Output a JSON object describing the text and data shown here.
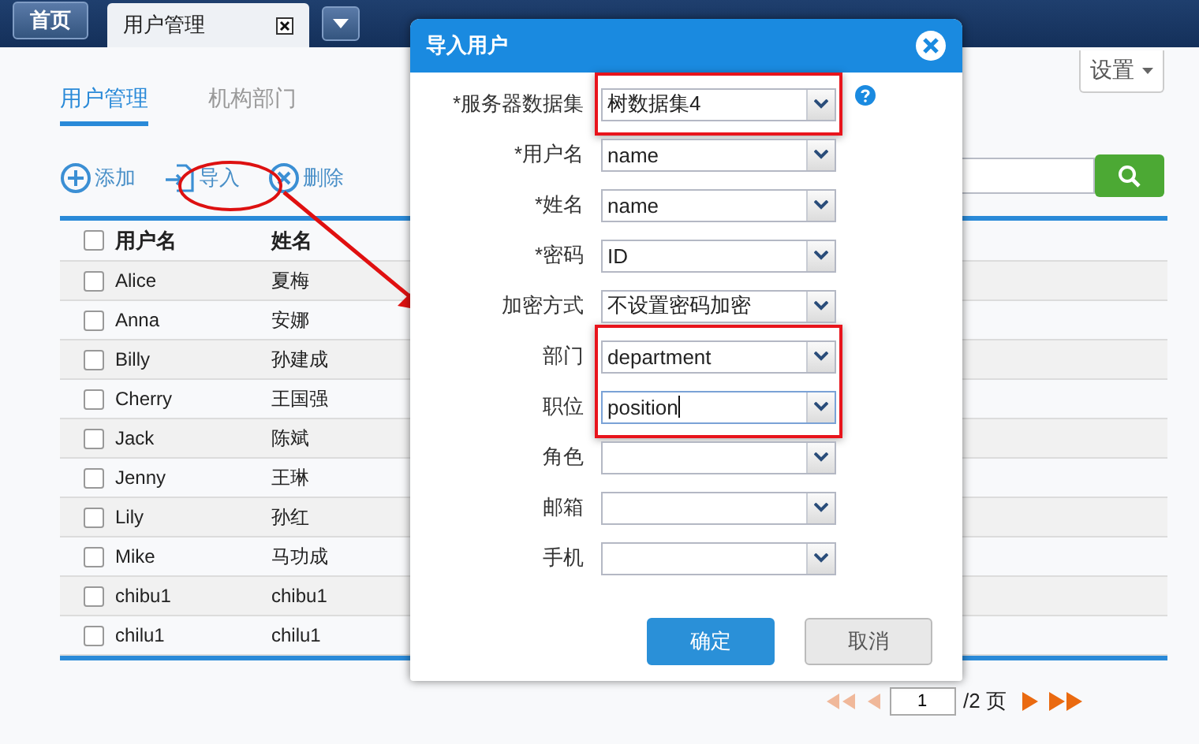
{
  "top_tabs": [
    {
      "label": "首页",
      "selected": false,
      "closable": false
    },
    {
      "label": "用户管理",
      "selected": true,
      "closable": true
    }
  ],
  "sub_tabs": [
    {
      "label": "用户管理",
      "selected": true
    },
    {
      "label": "机构部门",
      "selected": false
    }
  ],
  "settings_button": "设置",
  "toolbar": [
    {
      "kind": "add",
      "label": "添加"
    },
    {
      "kind": "import",
      "label": "导入"
    },
    {
      "kind": "delete",
      "label": "删除"
    }
  ],
  "table": {
    "columns": [
      "用户名",
      "姓名"
    ],
    "header_checked": false,
    "rows": [
      {
        "username": "Alice",
        "name": "夏梅",
        "checked": false
      },
      {
        "username": "Anna",
        "name": "安娜",
        "checked": false
      },
      {
        "username": "Billy",
        "name": "孙建成",
        "checked": false
      },
      {
        "username": "Cherry",
        "name": "王国强",
        "checked": false
      },
      {
        "username": "Jack",
        "name": "陈斌",
        "checked": false
      },
      {
        "username": "Jenny",
        "name": "王琳",
        "checked": false
      },
      {
        "username": "Lily",
        "name": "孙红",
        "checked": false
      },
      {
        "username": "Mike",
        "name": "马功成",
        "checked": false
      },
      {
        "username": "chibu1",
        "name": "chibu1",
        "checked": false
      },
      {
        "username": "chilu1",
        "name": "chilu1",
        "checked": false
      }
    ]
  },
  "pager": {
    "page": "1",
    "total": "/2 页"
  },
  "dialog": {
    "title": "导入用户",
    "fields": [
      {
        "label": "*服务器数据集",
        "value": "树数据集4",
        "highlighted": true,
        "help": true,
        "focused": false
      },
      {
        "label": "*用户名",
        "value": "name",
        "highlighted": false,
        "help": false,
        "focused": false
      },
      {
        "label": "*姓名",
        "value": "name",
        "highlighted": false,
        "help": false,
        "focused": false
      },
      {
        "label": "*密码",
        "value": "ID",
        "highlighted": false,
        "help": false,
        "focused": false
      },
      {
        "label": "加密方式",
        "value": "不设置密码加密",
        "highlighted": false,
        "help": false,
        "focused": false
      },
      {
        "label": "部门",
        "value": "department",
        "highlighted": true,
        "help": false,
        "focused": false
      },
      {
        "label": "职位",
        "value": "position",
        "highlighted": true,
        "help": false,
        "focused": true
      },
      {
        "label": "角色",
        "highlighted": false,
        "help": false,
        "focused": false
      },
      {
        "label": "邮箱",
        "highlighted": false,
        "help": false,
        "focused": false
      },
      {
        "label": "手机",
        "highlighted": false,
        "help": false,
        "focused": false
      }
    ],
    "buttons": [
      {
        "kind": "primary",
        "label": "确定"
      },
      {
        "kind": "secondary",
        "label": "取消"
      }
    ]
  }
}
